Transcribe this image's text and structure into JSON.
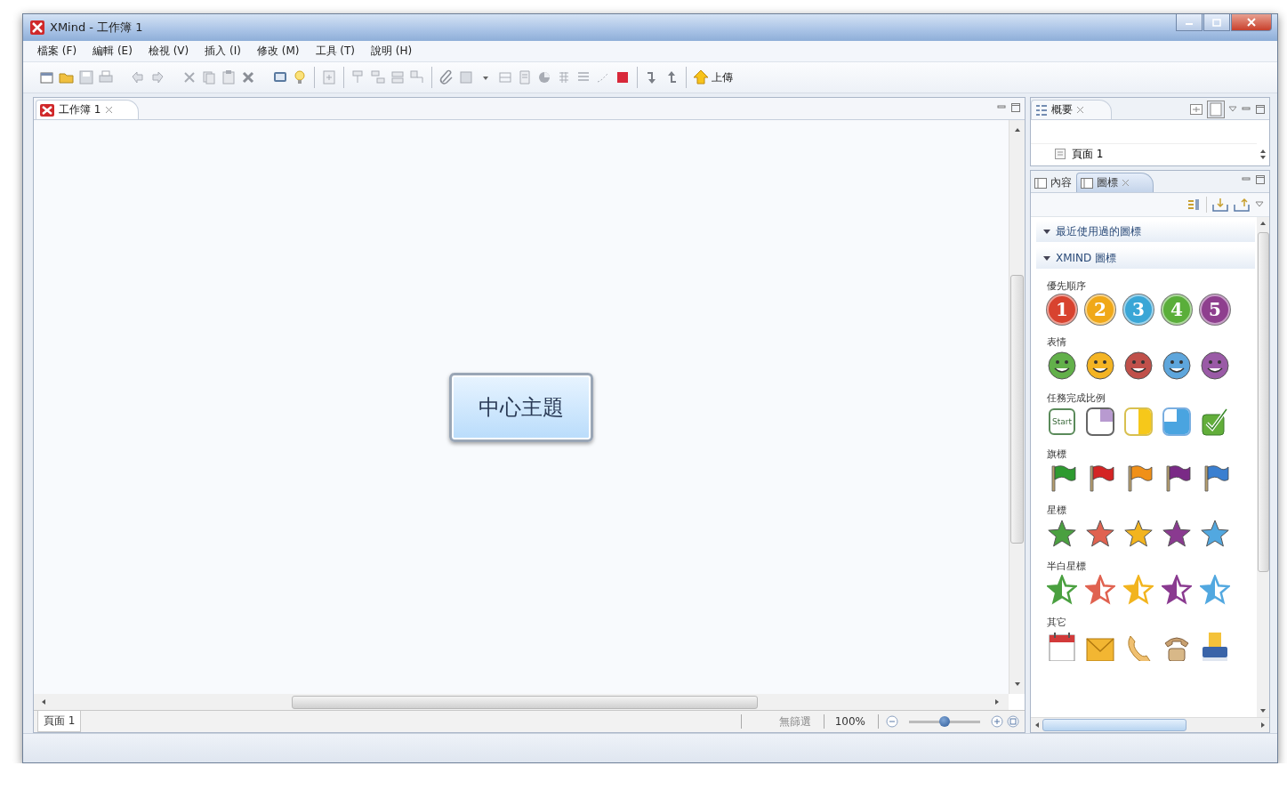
{
  "window": {
    "title": "XMind - 工作簿 1"
  },
  "menu": [
    "檔案 (F)",
    "編輯 (E)",
    "檢視 (V)",
    "插入 (I)",
    "修改 (M)",
    "工具 (T)",
    "說明 (H)"
  ],
  "toolbar": {
    "upload_label": "上傳"
  },
  "editor_tab": "工作簿 1",
  "central_topic": "中心主題",
  "sheet_tabs": [
    {
      "label": "頁面 1",
      "selected": true
    }
  ],
  "status": {
    "filter": "無篩選",
    "zoom": "100%",
    "zoom_slider": {
      "level": 0.5
    }
  },
  "outline": {
    "title": "概要",
    "items": [
      "頁面 1"
    ]
  },
  "marker_panel": {
    "tabs": [
      {
        "label": "內容",
        "selected": false
      },
      {
        "label": "圖標",
        "selected": true
      }
    ],
    "sections": [
      {
        "title": "最近使用過的圖標",
        "expanded": true
      },
      {
        "title": "XMIND 圖標",
        "expanded": true,
        "categories": [
          {
            "title": "優先順序",
            "kind": "priority",
            "icons": [
              {
                "label": "1",
                "color": "#d8432f"
              },
              {
                "label": "2",
                "color": "#f0a818"
              },
              {
                "label": "3",
                "color": "#3aa6d6"
              },
              {
                "label": "4",
                "color": "#5aae3a"
              },
              {
                "label": "5",
                "color": "#8e3f8e"
              }
            ]
          },
          {
            "title": "表情",
            "kind": "smiley",
            "icons": [
              {
                "color": "#62b04a"
              },
              {
                "color": "#f4b423"
              },
              {
                "color": "#c0504a"
              },
              {
                "color": "#5ea6dc"
              },
              {
                "color": "#9a5aa6"
              }
            ]
          },
          {
            "title": "任務完成比例",
            "kind": "progress",
            "icons": [
              {
                "kind": "start",
                "label": "Start"
              },
              {
                "kind": "quarter"
              },
              {
                "kind": "half"
              },
              {
                "kind": "three-quarter"
              },
              {
                "kind": "done"
              }
            ]
          },
          {
            "title": "旗標",
            "kind": "flag",
            "icons": [
              {
                "color": "#2e9a30"
              },
              {
                "color": "#d42424"
              },
              {
                "color": "#f09018"
              },
              {
                "color": "#7a2a86"
              },
              {
                "color": "#3a7fd0"
              }
            ]
          },
          {
            "title": "星標",
            "kind": "star",
            "icons": [
              {
                "color": "#4aa040"
              },
              {
                "color": "#e06250"
              },
              {
                "color": "#f2b41e"
              },
              {
                "color": "#8a3a90"
              },
              {
                "color": "#52a8e0"
              }
            ]
          },
          {
            "title": "半白星標",
            "kind": "half-star",
            "icons": [
              {
                "color": "#4aa040"
              },
              {
                "color": "#e06250"
              },
              {
                "color": "#f2b41e"
              },
              {
                "color": "#8a3a90"
              },
              {
                "color": "#52a8e0"
              }
            ]
          },
          {
            "title": "其它",
            "kind": "other",
            "icons": [
              {
                "kind": "calendar"
              },
              {
                "kind": "mail"
              },
              {
                "kind": "phone"
              },
              {
                "kind": "telephone"
              },
              {
                "kind": "printer"
              }
            ]
          }
        ]
      }
    ]
  }
}
